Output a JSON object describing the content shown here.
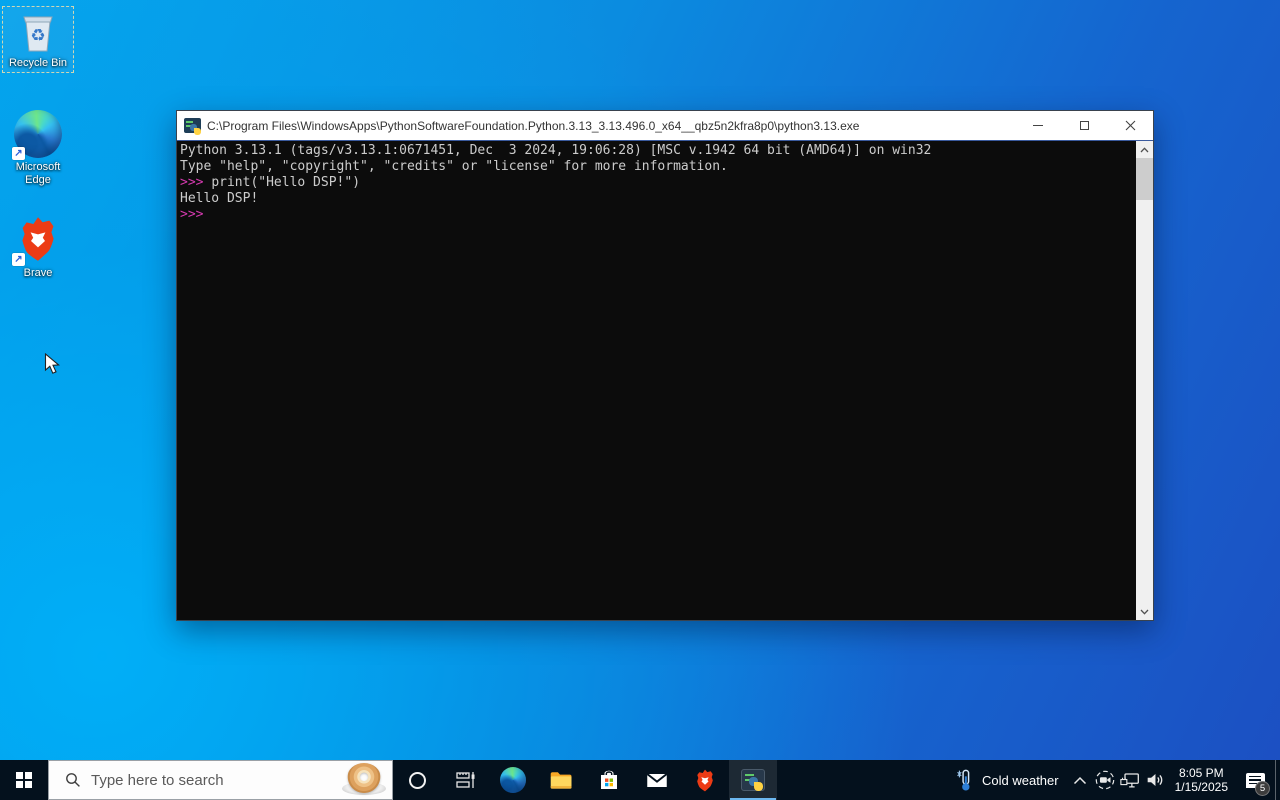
{
  "desktop": {
    "icons": [
      {
        "label": "Recycle Bin",
        "selected": true
      },
      {
        "label": "Microsoft Edge",
        "selected": false
      },
      {
        "label": "Brave",
        "selected": false
      }
    ]
  },
  "window": {
    "title": "C:\\Program Files\\WindowsApps\\PythonSoftwareFoundation.Python.3.13_3.13.496.0_x64__qbz5n2kfra8p0\\python3.13.exe",
    "console": {
      "lines": [
        {
          "prompt": "",
          "text": "Python 3.13.1 (tags/v3.13.1:0671451, Dec  3 2024, 19:06:28) [MSC v.1942 64 bit (AMD64)] on win32"
        },
        {
          "prompt": "",
          "text": "Type \"help\", \"copyright\", \"credits\" or \"license\" for more information."
        },
        {
          "prompt": ">>> ",
          "text": "print(\"Hello DSP!\")"
        },
        {
          "prompt": "",
          "text": "Hello DSP!"
        },
        {
          "prompt": ">>>",
          "text": ""
        }
      ]
    }
  },
  "taskbar": {
    "search": {
      "placeholder": "Type here to search"
    },
    "icons": [
      "start-windows-logo",
      "search-magnifier",
      "bing-daily-donut",
      "cortana-ring",
      "task-view",
      "edge-browser",
      "file-explorer",
      "microsoft-store",
      "mail",
      "brave-browser",
      "python-console-active",
      "weather-thermometer",
      "tray-chevron-up",
      "meet-now-camera",
      "network-ethernet",
      "volume-speaker",
      "action-center-bubble",
      "show-desktop-sliver"
    ],
    "tray": {
      "weather_label": "Cold weather",
      "time": "8:05 PM",
      "date": "1/15/2025",
      "notification_count": "5"
    }
  },
  "colors": {
    "desktop_light": "#06a7ee",
    "desktop_dark": "#1c4fc2",
    "taskbar_bg": "#04111d",
    "console_bg": "#0c0c0c",
    "console_text": "#cccccc",
    "prompt_magenta": "#d63ab0",
    "titlebar_bg": "#ffffff",
    "active_app_underline": "#6cb8f0"
  }
}
